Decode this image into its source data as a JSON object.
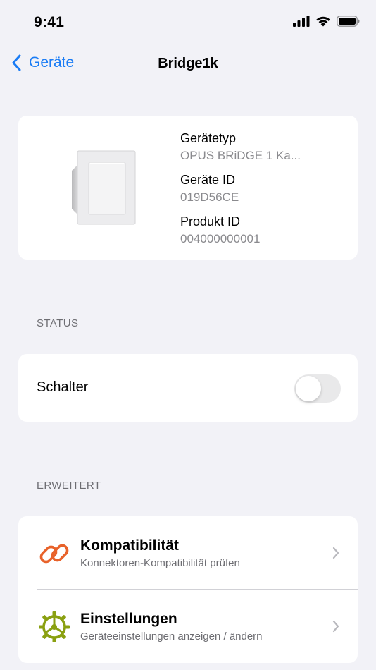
{
  "status_bar": {
    "time": "9:41"
  },
  "nav": {
    "back_label": "Geräte",
    "title": "Bridge1k"
  },
  "device": {
    "type_label": "Gerätetyp",
    "type_value": "OPUS BRiDGE 1 Ka...",
    "id_label": "Geräte ID",
    "id_value": "019D56CE",
    "product_label": "Produkt ID",
    "product_value": "004000000001"
  },
  "status_section": {
    "header": "STATUS",
    "switch_label": "Schalter",
    "switch_on": false
  },
  "advanced_section": {
    "header": "ERWEITERT",
    "items": [
      {
        "title": "Kompatibilität",
        "subtitle": "Konnektoren-Kompatibilität prüfen",
        "icon": "link-icon"
      },
      {
        "title": "Einstellungen",
        "subtitle": "Geräteeinstellungen anzeigen / ändern",
        "icon": "gear-icon"
      }
    ]
  },
  "colors": {
    "accent": "#1a7cf5",
    "background": "#f2f2f7",
    "link_icon": "#e8622a",
    "gear_icon": "#8aa011"
  }
}
